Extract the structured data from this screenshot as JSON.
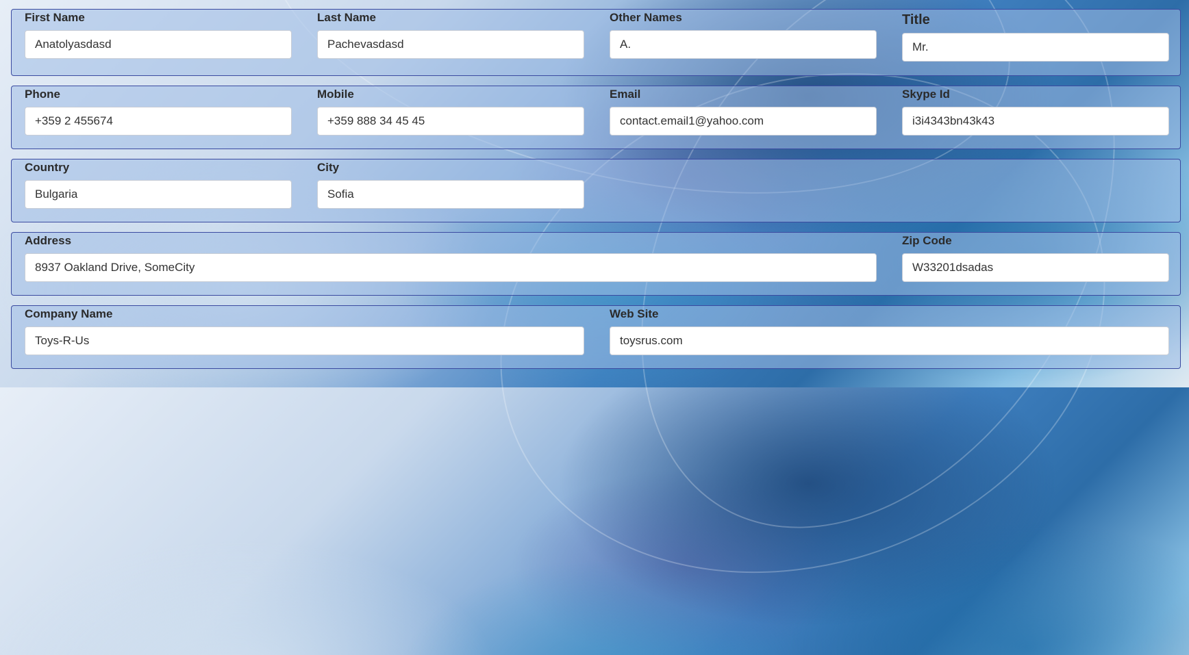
{
  "row1": {
    "first_name": {
      "label": "First Name",
      "value": "Anatolyasdasd"
    },
    "last_name": {
      "label": "Last Name",
      "value": "Pachevasdasd"
    },
    "other_names": {
      "label": "Other Names",
      "value": "A."
    },
    "title": {
      "label": "Title",
      "value": "Mr."
    }
  },
  "row2": {
    "phone": {
      "label": "Phone",
      "value": "+359 2 455674"
    },
    "mobile": {
      "label": "Mobile",
      "value": "+359 888 34 45 45"
    },
    "email": {
      "label": "Email",
      "value": "contact.email1@yahoo.com"
    },
    "skype": {
      "label": "Skype Id",
      "value": "i3i4343bn43k43"
    }
  },
  "row3": {
    "country": {
      "label": "Country",
      "value": "Bulgaria"
    },
    "city": {
      "label": "City",
      "value": "Sofia"
    }
  },
  "row4": {
    "address": {
      "label": "Address",
      "value": "8937 Oakland Drive, SomeCity"
    },
    "zip": {
      "label": "Zip Code",
      "value": "W33201dsadas"
    }
  },
  "row5": {
    "company": {
      "label": "Company Name",
      "value": "Toys-R-Us"
    },
    "website": {
      "label": "Web Site",
      "value": "toysrus.com"
    }
  }
}
